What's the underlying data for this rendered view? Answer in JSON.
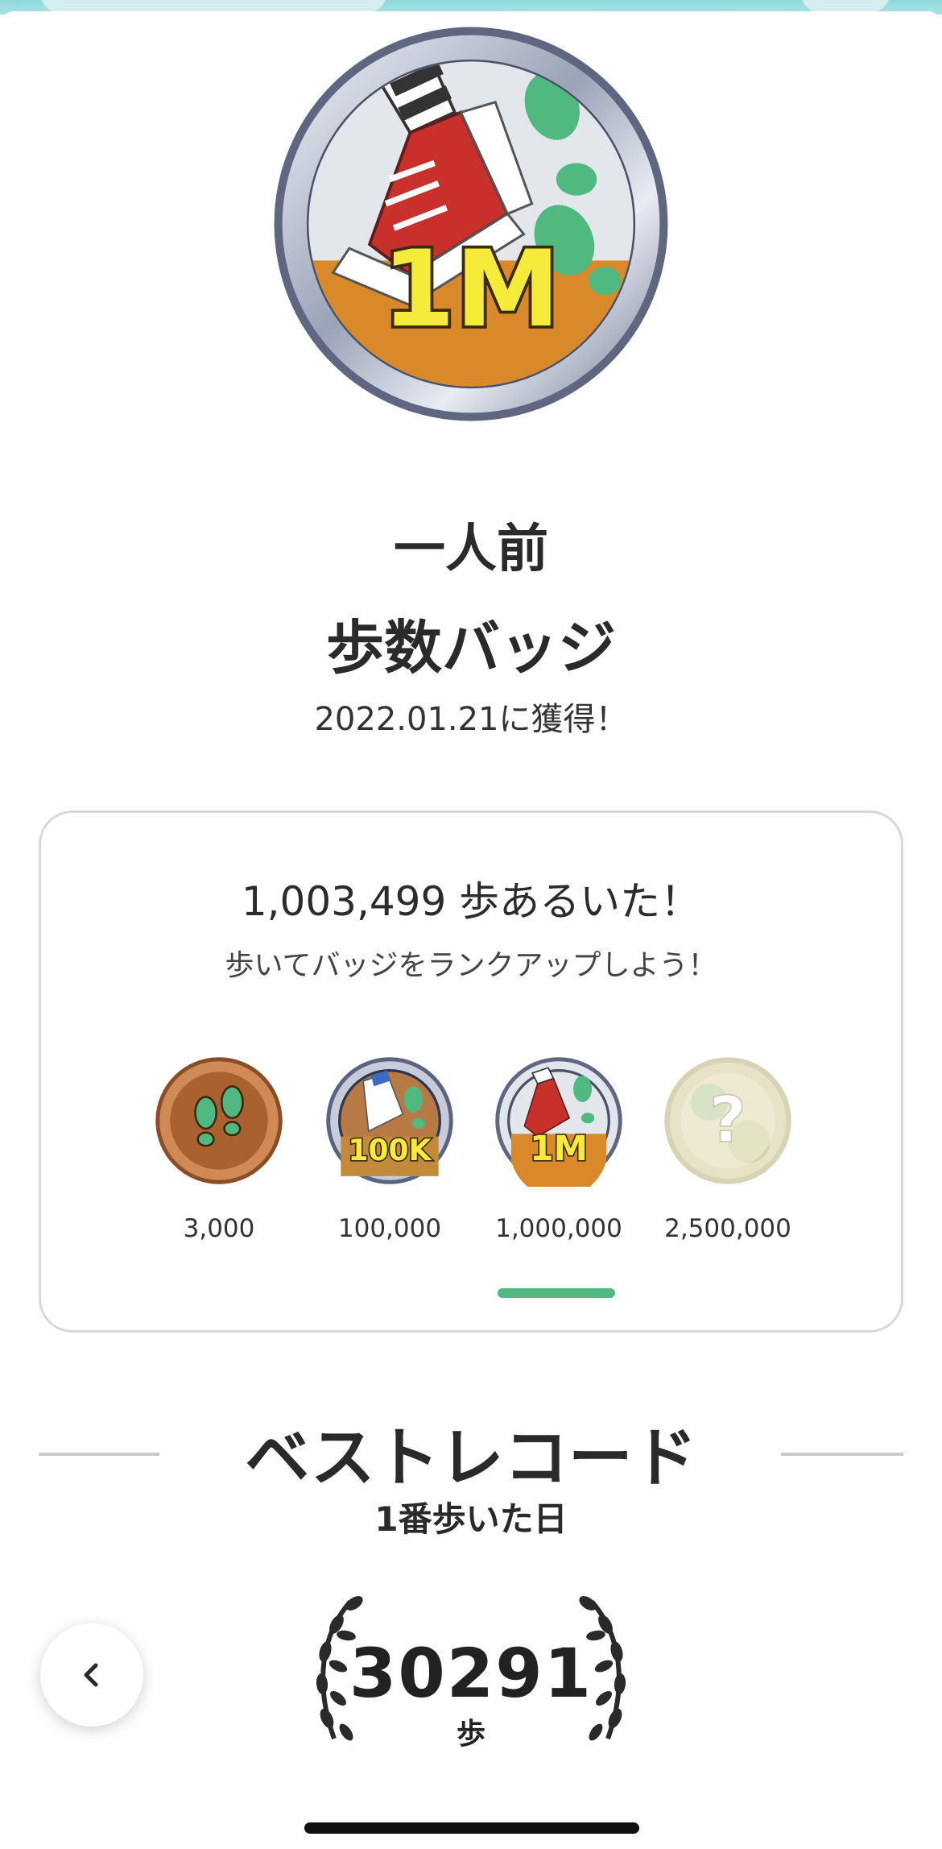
{
  "badge": {
    "title_line1": "一人前",
    "title_line2": "歩数バッジ",
    "earned_date": "2022.01.21に獲得！",
    "medal_text": "1M"
  },
  "progress_card": {
    "steps_walked": "1,003,499 歩あるいた！",
    "rankup_message": "歩いてバッジをランクアップしよう！",
    "badges": [
      {
        "label": "3,000",
        "icon": "bronze-footprints-medal"
      },
      {
        "label": "100,000",
        "icon": "100k-shoe-medal",
        "medal_text": "100K"
      },
      {
        "label": "1,000,000",
        "icon": "1m-shoe-medal",
        "medal_text": "1M",
        "selected": true
      },
      {
        "label": "2,500,000",
        "icon": "locked-question-medal",
        "medal_text": "?"
      }
    ]
  },
  "best_record": {
    "title": "ベストレコード",
    "subtitle": "1番歩いた日",
    "steps": "30291",
    "unit": "歩"
  },
  "colors": {
    "accent_green": "#4fb97f",
    "medal_orange": "#d9892a",
    "medal_yellow": "#f6ea3a",
    "shoe_red": "#c8302b"
  },
  "icons": {
    "back": "chevron-left-icon"
  }
}
